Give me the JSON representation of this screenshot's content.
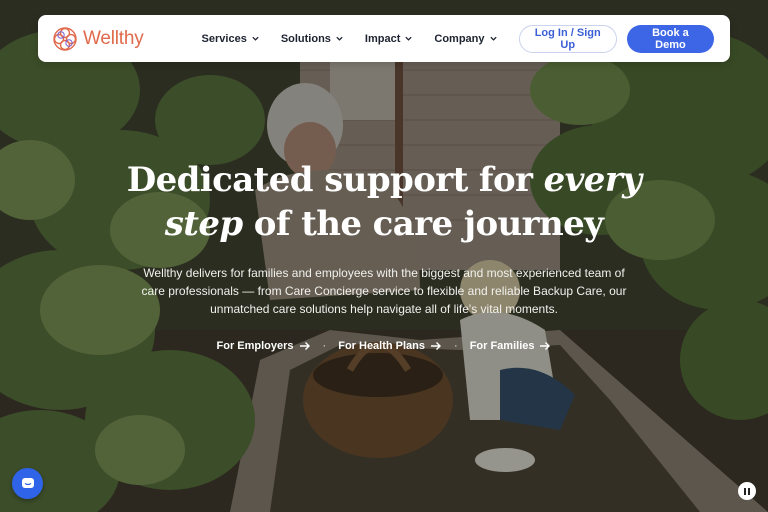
{
  "brand": {
    "name": "Wellthy",
    "logo_color": "#e06a4c"
  },
  "nav": {
    "items": [
      {
        "label": "Services",
        "icon": "chevron-down-icon"
      },
      {
        "label": "Solutions",
        "icon": "chevron-down-icon"
      },
      {
        "label": "Impact",
        "icon": "chevron-down-icon"
      },
      {
        "label": "Company",
        "icon": "chevron-down-icon"
      }
    ],
    "login_label": "Log In / Sign Up",
    "demo_label": "Book a Demo"
  },
  "hero": {
    "headline_part1": "Dedicated support for ",
    "headline_em1": "every",
    "headline_em2": "step",
    "headline_part2": " of the care journey",
    "description": "Wellthy delivers for families and employees with the biggest and most experienced team of care professionals — from Care Concierge service to flexible and reliable Backup Care, our unmatched care solutions help navigate all of life's vital moments.",
    "ctas": [
      {
        "label": "For Employers",
        "icon": "arrow-right-icon"
      },
      {
        "label": "For Health Plans",
        "icon": "arrow-right-icon"
      },
      {
        "label": "For Families",
        "icon": "arrow-right-icon"
      }
    ],
    "separator": "·"
  },
  "widgets": {
    "chat_icon": "chat-icon",
    "pause_icon": "pause-icon"
  },
  "colors": {
    "accent": "#3d66e6",
    "login_text": "#3a5fd6",
    "nav_text": "#1d2330"
  }
}
